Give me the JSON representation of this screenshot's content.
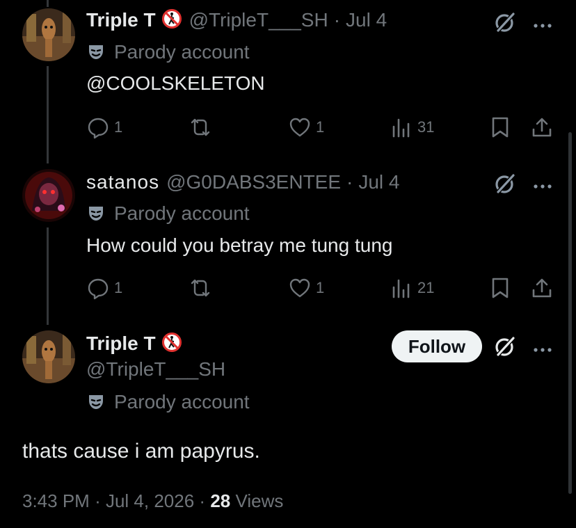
{
  "tweets": [
    {
      "name": "Triple T",
      "handle": "@TripleT___SH",
      "sep": "·",
      "date": "Jul 4",
      "parody_label": "Parody account",
      "text": "@COOLSKELETON",
      "replies": "1",
      "likes": "1",
      "views": "31"
    },
    {
      "name": "satanos",
      "handle": "@G0DABS3ENTEE",
      "sep": "·",
      "date": "Jul 4",
      "parody_label": "Parody account",
      "text": "How could you betray me tung tung",
      "replies": "1",
      "likes": "1",
      "views": "21"
    }
  ],
  "main": {
    "name": "Triple T",
    "handle": "@TripleT___SH",
    "parody_label": "Parody account",
    "follow_label": "Follow",
    "text": "thats cause i am papyrus.",
    "time": "3:43 PM",
    "sep1": "·",
    "date": "Jul 4, 2026",
    "sep2": "·",
    "views_count": "28",
    "views_label": "Views"
  },
  "icons": {
    "no_pedestrian": "no-pedestrians-icon",
    "grok": "grok-icon",
    "more": "more-icon",
    "parody": "mask-icon",
    "reply": "reply-icon",
    "retweet": "retweet-icon",
    "like": "heart-icon",
    "views": "views-icon",
    "bookmark": "bookmark-icon",
    "share": "share-icon"
  }
}
